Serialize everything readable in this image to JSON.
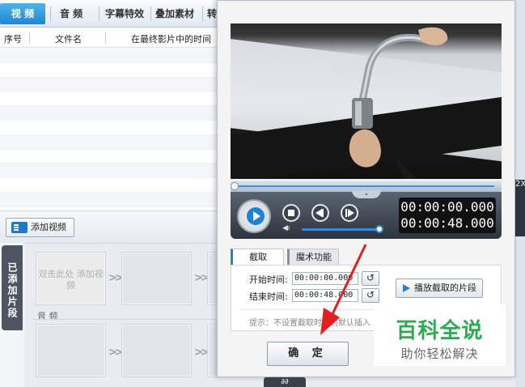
{
  "main": {
    "tabs": [
      {
        "label": "视 频",
        "active": true
      },
      {
        "label": "音 频"
      },
      {
        "label": "字幕特效"
      },
      {
        "label": "叠加素材"
      },
      {
        "label": "转"
      }
    ],
    "columns": [
      "序号",
      "文件名",
      "在最终影片中的时间"
    ],
    "add_video_button": "添加视频",
    "added_clips_label": "已添加片段",
    "first_clip_hint": "双击此处 添加视频",
    "audio_label": "音 频",
    "right_partial": "2X"
  },
  "dialog": {
    "player": {
      "current_time": "00:00:00.000",
      "total_time": "00:00:48.000"
    },
    "tabs": [
      {
        "label": "截取",
        "active": true
      },
      {
        "label": "魔术功能"
      }
    ],
    "start_label": "开始时间:",
    "start_value": "00:00:00.000",
    "end_label": "结束时间:",
    "end_value": "00:00:48.000",
    "play_clip_button": "播放截取的片段",
    "hint": "提示：不设置截取时间则默认插入",
    "ok_button": "确 定",
    "bottom_tag": "∂∂"
  },
  "watermark": {
    "title": "百科全说",
    "subtitle": "助你轻松解决"
  },
  "colors": {
    "accent": "#1f86cf",
    "watermark_green": "#2eaa55",
    "arrow_red": "#e02020"
  }
}
